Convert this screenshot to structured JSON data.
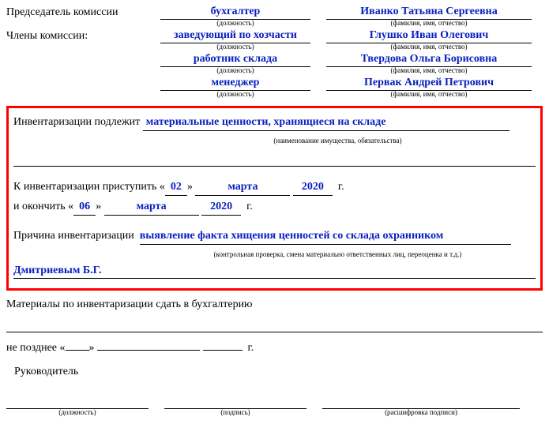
{
  "commission": {
    "chair_label": "Председатель комиссии",
    "members_label": "Члены комиссии:",
    "pos_sublabel": "(должность)",
    "name_sublabel": "(фамилия, имя, отчество)",
    "chair": {
      "position": "бухгалтер",
      "name": "Иванко Татьяна Сергеевна"
    },
    "members": [
      {
        "position": "заведующий по хозчасти",
        "name": "Глушко Иван Олегович"
      },
      {
        "position": "работник склада",
        "name": "Твердова Ольга Борисовна"
      },
      {
        "position": "менеджер",
        "name": "Первак Андрей Петрович"
      }
    ]
  },
  "inventory": {
    "subject_label": "Инвентаризации подлежит",
    "subject_value": "материальные ценности, хранящиеся на складе",
    "subject_sublabel": "(наименование имущества, обязательства)",
    "start_label": "К инвентаризации приступить «",
    "end_label": "и окончить «",
    "year_suffix": "г.",
    "close_quote": "»",
    "start": {
      "day": "02",
      "month": "марта",
      "year": "2020"
    },
    "end": {
      "day": "06",
      "month": "марта",
      "year": "2020"
    },
    "reason_label": "Причина инвентаризации",
    "reason_value": "выявление факта хищения ценностей со склада охранником",
    "reason_sublabel": "(контрольная проверка, смена материально ответственных лиц, переоценка и т.д.)",
    "reason_cont": "Дмитриевым Б.Г."
  },
  "footer": {
    "materials_label": "Материалы по инвентаризации сдать в бухгалтерию",
    "deadline_label": "не позднее «",
    "deadline_close": "»",
    "deadline_suffix": "г.",
    "leader_label": "Руководитель",
    "sig_pos": "(должность)",
    "sig_sign": "(подпись)",
    "sig_decipher": "(расшифровка подписи)"
  }
}
